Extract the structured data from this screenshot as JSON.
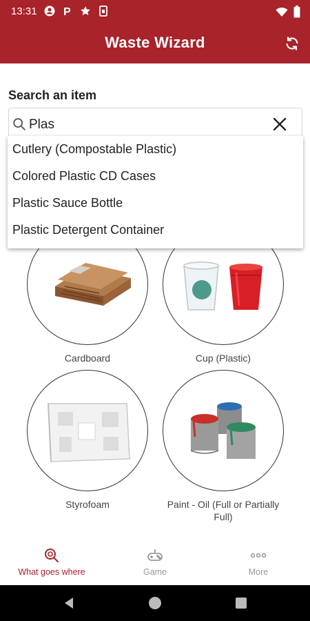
{
  "status_bar": {
    "time": "13:31",
    "icons": [
      "account-icon",
      "parking-icon",
      "star-icon",
      "sim-icon",
      "wifi-icon",
      "battery-icon"
    ]
  },
  "app_bar": {
    "title": "Waste Wizard",
    "refresh_icon": "refresh-icon",
    "color": "#a8232a"
  },
  "search": {
    "label": "Search an item",
    "value": "Plas",
    "clear_icon": "close-icon"
  },
  "suggestions": [
    "Cutlery (Compostable Plastic)",
    "Colored Plastic CD Cases",
    "Plastic Sauce Bottle",
    "Plastic Detergent Container"
  ],
  "items": [
    {
      "label": "Cardboard",
      "icon": "cardboard-image"
    },
    {
      "label": "Cup (Plastic)",
      "icon": "plastic-cups-image"
    },
    {
      "label": "Styrofoam",
      "icon": "styrofoam-image"
    },
    {
      "label": "Paint - Oil (Full or Partially Full)",
      "icon": "paint-cans-image"
    }
  ],
  "bottom_nav": [
    {
      "label": "What goes where",
      "icon": "search-recycle-icon",
      "active": true
    },
    {
      "label": "Game",
      "icon": "gamepad-icon",
      "active": false
    },
    {
      "label": "More",
      "icon": "more-icon",
      "active": false
    }
  ]
}
